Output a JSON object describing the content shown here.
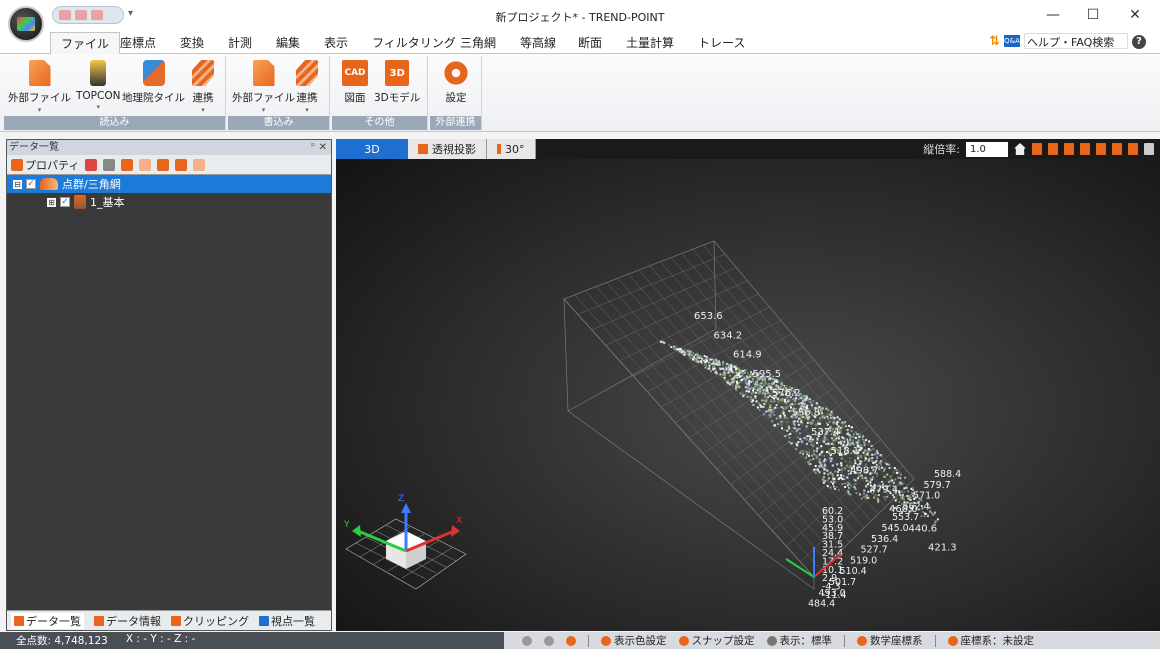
{
  "window": {
    "title": "新プロジェクト* - TREND-POINT",
    "minimize": "—",
    "maximize": "☐",
    "close": "✕"
  },
  "tabs": [
    "ファイル",
    "座標点",
    "変換",
    "計測",
    "編集",
    "表示",
    "フィルタリング",
    "三角網",
    "等高線",
    "断面",
    "土量計算",
    "トレース"
  ],
  "help": {
    "badge": "Q&A",
    "label": "ヘルプ・FAQ検索",
    "question_mark": "?"
  },
  "ribbon": {
    "groups": [
      {
        "label": "読込み",
        "buttons": [
          "外部ファイル",
          "TOPCON",
          "地理院タイル",
          "連携"
        ]
      },
      {
        "label": "書込み",
        "buttons": [
          "外部ファイル",
          "連携"
        ]
      },
      {
        "label": "その他",
        "buttons": [
          "図面",
          "3Dモデル"
        ]
      },
      {
        "label": "外部連携",
        "buttons": [
          "設定"
        ]
      }
    ],
    "icon_text": {
      "cad": "CAD",
      "three_d": "3D"
    }
  },
  "left_panel": {
    "title": "データ一覧",
    "pin": "ᵖ",
    "close": "✕",
    "toolbar_property": "プロパティ",
    "tree": [
      {
        "label": "点群/三角網",
        "selected": true,
        "expander": "⊟"
      },
      {
        "label": "1_基本",
        "selected": false,
        "expander": "⊞"
      }
    ],
    "bottom_tabs": [
      "データ一覧",
      "データ情報",
      "クリッピング",
      "視点一覧"
    ]
  },
  "viewport": {
    "mode": "3D",
    "projection": "透視投影",
    "fov": "30°",
    "vertical_scale_label": "縦倍率:",
    "vertical_scale_value": "1.0",
    "axis_labels_main": [
      "653.6",
      "634.2",
      "614.9",
      "595.5",
      "576.2",
      "556.8",
      "537.4",
      "518.1",
      "498.7",
      "479.4",
      "460.0",
      "440.6",
      "421.3"
    ],
    "axis_labels_side": [
      "588.4",
      "579.7",
      "571.0",
      "562.4",
      "553.7",
      "545.0",
      "536.4",
      "527.7",
      "519.0",
      "510.4",
      "501.7",
      "493.0",
      "484.4"
    ],
    "axis_labels_z": [
      "60.2",
      "53.0",
      "45.9",
      "38.7",
      "31.5",
      "24.4",
      "17.2",
      "10.1",
      "2.9",
      "-4.3",
      "-11.4"
    ],
    "gizmo": {
      "x": "X",
      "y": "Y",
      "z": "Z"
    }
  },
  "statusbar": {
    "point_count": "全点数: 4,748,123",
    "coords": "X : - Y : - Z : -",
    "items": [
      "表示色設定",
      "スナップ設定",
      "表示：標準",
      "数学座標系",
      "座標系：未設定"
    ]
  },
  "colors": {
    "accent": "#1e7ad8",
    "orange": "#e8661c",
    "viewport_bg": "#2b2b2b"
  }
}
